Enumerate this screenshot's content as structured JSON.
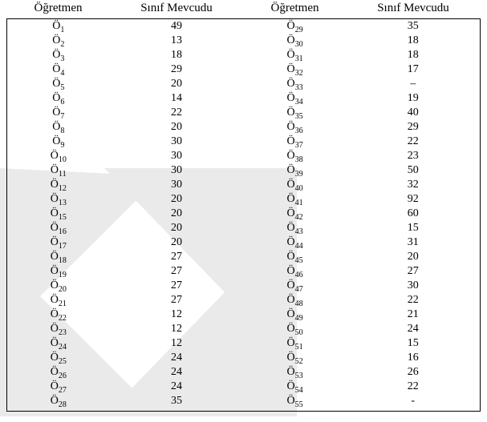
{
  "headers": {
    "col1": "Öğretmen",
    "col2": "Sınıf Mevcudu",
    "col3": "Öğretmen",
    "col4": "Sınıf Mevcudu"
  },
  "label_prefix": "Ö",
  "chart_data": {
    "type": "table",
    "title": "",
    "columns": [
      "Öğretmen",
      "Sınıf Mevcudu",
      "Öğretmen",
      "Sınıf Mevcudu"
    ],
    "rows": [
      {
        "left_id": "1",
        "left_val": "49",
        "right_id": "29",
        "right_val": "35"
      },
      {
        "left_id": "2",
        "left_val": "13",
        "right_id": "30",
        "right_val": "18"
      },
      {
        "left_id": "3",
        "left_val": "18",
        "right_id": "31",
        "right_val": "18"
      },
      {
        "left_id": "4",
        "left_val": "29",
        "right_id": "32",
        "right_val": "17"
      },
      {
        "left_id": "5",
        "left_val": "20",
        "right_id": "33",
        "right_val": "–"
      },
      {
        "left_id": "6",
        "left_val": "14",
        "right_id": "34",
        "right_val": "19"
      },
      {
        "left_id": "7",
        "left_val": "22",
        "right_id": "35",
        "right_val": "40"
      },
      {
        "left_id": "8",
        "left_val": "20",
        "right_id": "36",
        "right_val": "29"
      },
      {
        "left_id": "9",
        "left_val": "30",
        "right_id": "37",
        "right_val": "22"
      },
      {
        "left_id": "10",
        "left_val": "30",
        "right_id": "38",
        "right_val": "23"
      },
      {
        "left_id": "11",
        "left_val": "30",
        "right_id": "39",
        "right_val": "50"
      },
      {
        "left_id": "12",
        "left_val": "30",
        "right_id": "40",
        "right_val": "32"
      },
      {
        "left_id": "13",
        "left_val": "20",
        "right_id": "41",
        "right_val": "92"
      },
      {
        "left_id": "15",
        "left_val": "20",
        "right_id": "42",
        "right_val": "60"
      },
      {
        "left_id": "16",
        "left_val": "20",
        "right_id": "43",
        "right_val": "15"
      },
      {
        "left_id": "17",
        "left_val": "20",
        "right_id": "44",
        "right_val": "31"
      },
      {
        "left_id": "18",
        "left_val": "27",
        "right_id": "45",
        "right_val": "20"
      },
      {
        "left_id": "19",
        "left_val": "27",
        "right_id": "46",
        "right_val": "27"
      },
      {
        "left_id": "20",
        "left_val": "27",
        "right_id": "47",
        "right_val": "30"
      },
      {
        "left_id": "21",
        "left_val": "27",
        "right_id": "48",
        "right_val": "22"
      },
      {
        "left_id": "22",
        "left_val": "12",
        "right_id": "49",
        "right_val": "21"
      },
      {
        "left_id": "23",
        "left_val": "12",
        "right_id": "50",
        "right_val": "24"
      },
      {
        "left_id": "24",
        "left_val": "12",
        "right_id": "51",
        "right_val": "15"
      },
      {
        "left_id": "25",
        "left_val": "24",
        "right_id": "52",
        "right_val": "16"
      },
      {
        "left_id": "26",
        "left_val": "24",
        "right_id": "53",
        "right_val": "26"
      },
      {
        "left_id": "27",
        "left_val": "24",
        "right_id": "54",
        "right_val": "22"
      },
      {
        "left_id": "28",
        "left_val": "35",
        "right_id": "55",
        "right_val": "-"
      }
    ]
  }
}
